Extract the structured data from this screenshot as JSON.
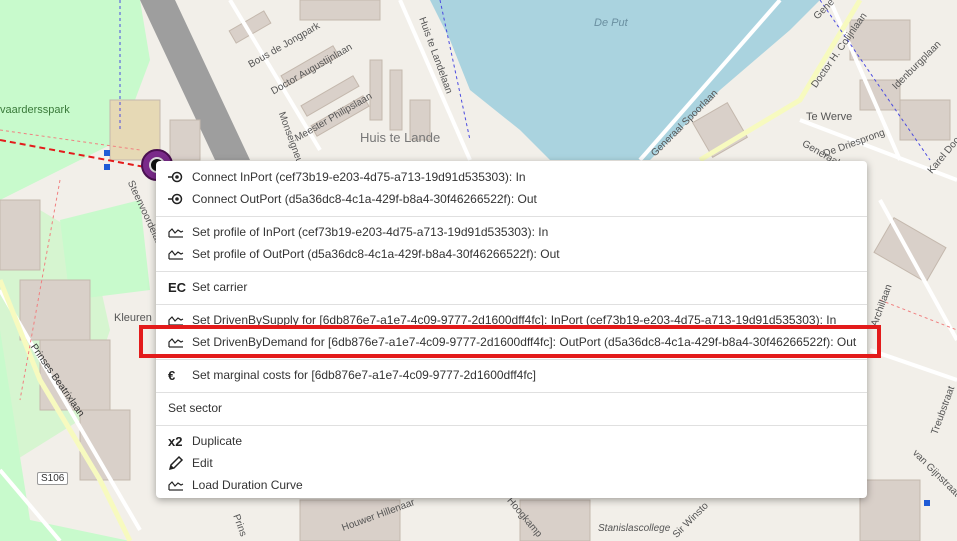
{
  "map": {
    "labels": {
      "de_put": "De Put",
      "huis_te_lande": "Huis te Lande",
      "te_werve": "Te Werve",
      "park": "vaardersspark",
      "bous": "Bous de Jongpark",
      "augustijnlaan": "Doctor Augustijnlaan",
      "philipslaan": "Meester Philipslaan",
      "langelaan": "Huis te Landelaan",
      "spoorlaan": "Generaal Spoorlaan",
      "colijnlaan": "Doctor H. Colijnlaan",
      "idenburg": "Idenburgplaan",
      "driesprong": "De Driesprong",
      "prinses": "Prinses Beatrixlaan",
      "kleuren": "Kleuren",
      "s106": "S106",
      "treubstraat": "Treubstraat",
      "stanislas": "Stanislascollege",
      "gijnstraat": "van Gijnstraat",
      "karel": "Karel Doo",
      "sir_winston": "Sir Winsto",
      "generaal_top": "Gene",
      "hillenaar": "Houwer Hillenaar",
      "hoogkamp": "Hoogkamp",
      "steenvoorde": "Steenvoordelaan",
      "monseigneur": "Monseigneur",
      "generaal2": "Generaal",
      "prins": "Prins",
      "archilaan": "Archillaan"
    }
  },
  "context_menu": {
    "groups": [
      [
        {
          "icon": "connect-icon",
          "label": "Connect InPort (cef73b19-e203-4d75-a713-19d91d535303): In"
        },
        {
          "icon": "connect-icon",
          "label": "Connect OutPort (d5a36dc8-4c1a-429f-b8a4-30f46266522f): Out"
        }
      ],
      [
        {
          "icon": "profile-chart-icon",
          "label": "Set profile of InPort (cef73b19-e203-4d75-a713-19d91d535303): In"
        },
        {
          "icon": "profile-chart-icon",
          "label": "Set profile of OutPort (d5a36dc8-4c1a-429f-b8a4-30f46266522f): Out"
        }
      ],
      [
        {
          "icon": "ec-icon",
          "icon_text": "EC",
          "label": "Set carrier"
        }
      ],
      [
        {
          "icon": "profile-chart-icon",
          "label": "Set DrivenBySupply for [6db876e7-a1e7-4c09-9777-2d1600dff4fc]: InPort (cef73b19-e203-4d75-a713-19d91d535303): In"
        },
        {
          "icon": "profile-chart-icon",
          "label": "Set DrivenByDemand for [6db876e7-a1e7-4c09-9777-2d1600dff4fc]: OutPort (d5a36dc8-4c1a-429f-b8a4-30f46266522f): Out"
        }
      ],
      [
        {
          "icon": "euro-icon",
          "icon_text": "€",
          "label": "Set marginal costs for [6db876e7-a1e7-4c09-9777-2d1600dff4fc]"
        }
      ],
      [
        {
          "icon": "",
          "label": "Set sector"
        }
      ],
      [
        {
          "icon": "duplicate-icon",
          "icon_text": "x2",
          "label": "Duplicate"
        },
        {
          "icon": "pencil-icon",
          "label": "Edit"
        },
        {
          "icon": "profile-chart-icon",
          "label": "Load Duration Curve"
        }
      ]
    ],
    "highlighted_item": "Set DrivenByDemand for [6db876e7-a1e7-4c09-9777-2d1600dff4fc]: OutPort (d5a36dc8-4c1a-429f-b8a4-30f46266522f): Out"
  },
  "colors": {
    "map_background": "#f2efe9",
    "park_green": "#c8facc",
    "water": "#aad3df",
    "building": "#d9d0c9",
    "highlight_red": "#e31b1b",
    "asset_purple": "#7a2a8a"
  }
}
